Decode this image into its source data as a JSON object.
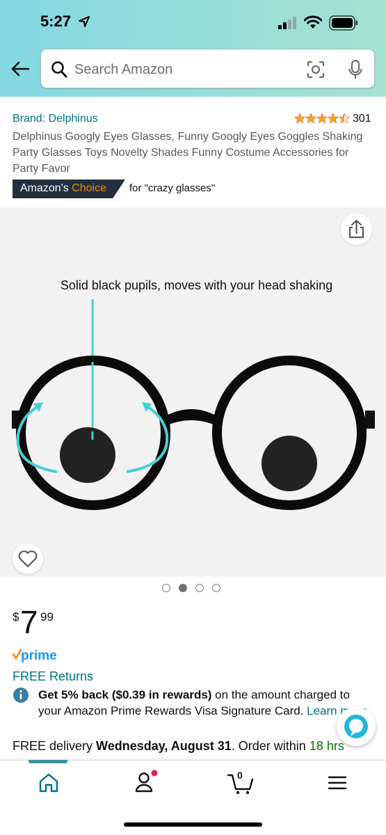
{
  "status_bar": {
    "time": "5:27"
  },
  "search": {
    "placeholder": "Search Amazon"
  },
  "product": {
    "brand": "Brand: Delphinus",
    "rating_count": "301",
    "rating_stars": 4.5,
    "title": "Delphinus Googly Eyes Glasses, Funny Googly Eyes Goggles Shaking Party Glasses Toys Novelty Shades Funny Costume Accessories for Party Favor",
    "choice_label_a": "Amazon's ",
    "choice_label_b": "Choice",
    "choice_for": "for \"crazy glasses\""
  },
  "gallery": {
    "caption": "Solid black pupils, moves with your head shaking",
    "image_count": 4,
    "active_index": 1
  },
  "price": {
    "symbol": "$",
    "whole": "7",
    "fraction": "99"
  },
  "prime_label": "prime",
  "free_returns": "FREE Returns",
  "rewards": {
    "bold": "Get 5% back ($0.39 in rewards)",
    "text": " on the amount charged to your Amazon Prime Rewards Visa Signature Card. ",
    "link": "Learn more."
  },
  "delivery": {
    "prefix": "FREE delivery ",
    "date": "Wednesday, August 31",
    "mid": ". Order within ",
    "countdown": "18 hrs"
  },
  "cart": {
    "count": "0"
  },
  "colors": {
    "link": "#007185",
    "badge_bg": "#232F3E",
    "badge_accent": "#F08804",
    "star": "#FFA41C",
    "green": "#007600",
    "prime_blue": "#1399FF"
  }
}
